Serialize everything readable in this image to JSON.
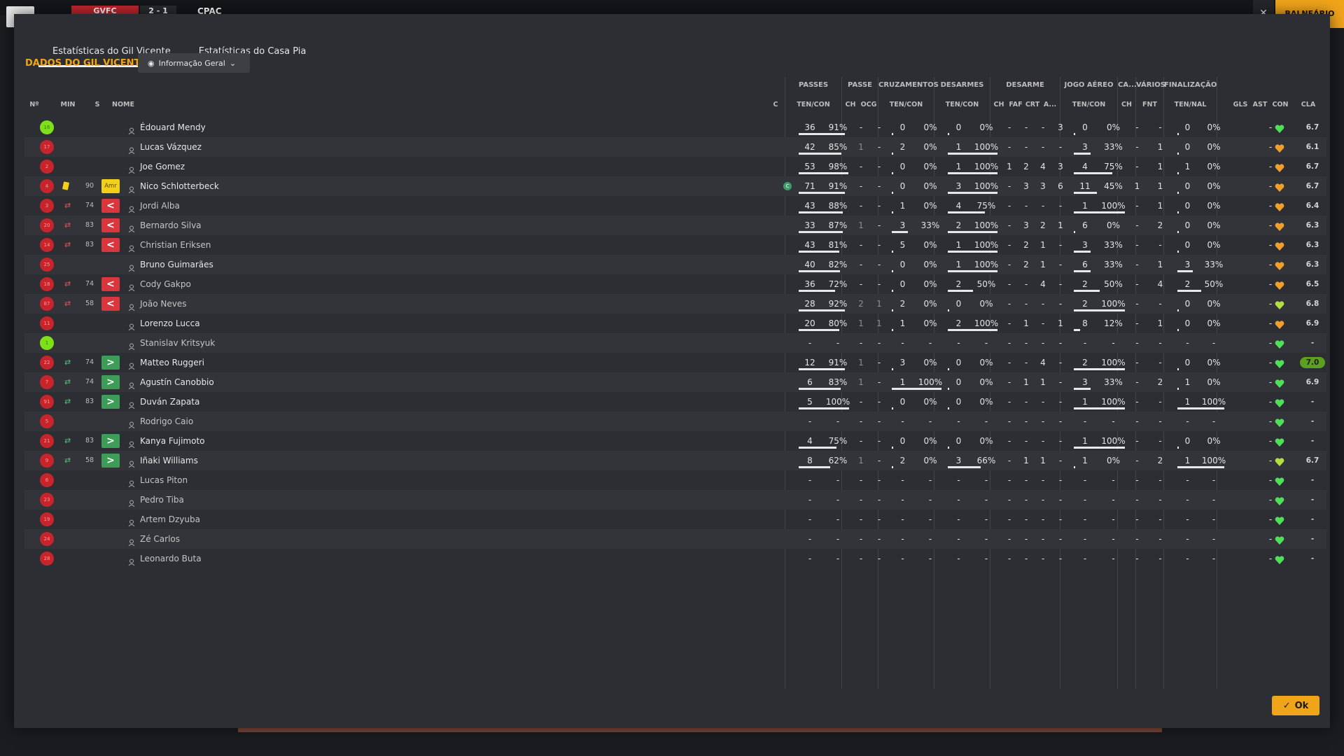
{
  "topbar": {
    "home_team": "GVFC",
    "score": "2 - 1",
    "away_team": "CPAC",
    "close_label": "✕",
    "dressing_room": "BALNEÁRIO"
  },
  "tabs": [
    {
      "label": "Estatísticas do Gil Vicente",
      "active": true
    },
    {
      "label": "Estatísticas do Casa Pia",
      "active": false
    }
  ],
  "section_title": "DADOS DO GIL VICENTE",
  "view_dropdown": "Informação Geral",
  "groups": [
    "PASSES",
    "PASSE",
    "CRUZAMENTOS",
    "DESARMES",
    "DESARME",
    "JOGO AÉREO",
    "CA...",
    "VÁRIOS",
    "FINALIZAÇÃO"
  ],
  "headers": {
    "num": "Nº",
    "min": "MIN",
    "s": "S",
    "name": "NOME",
    "c": "C",
    "passes": "TEN/CON",
    "passe_ch": "CH",
    "passe_ocg": "OCG",
    "cruz": "TEN/CON",
    "desarmes": "TEN/CON",
    "d_ch": "CH",
    "d_faf": "FAF",
    "d_crt": "CRT",
    "d_a": "A...",
    "aereo": "TEN/CON",
    "ca_ch": "CH",
    "fnt": "FNT",
    "finaliz": "TEN/NAL",
    "gls": "GLS",
    "ast": "AST",
    "con": "CON",
    "cla": "CLA"
  },
  "players": [
    {
      "num": "16",
      "gk": true,
      "min": "",
      "event": "",
      "s": "",
      "name": "Édouard Mendy",
      "active": true,
      "c": "",
      "p": [
        "36",
        "91%"
      ],
      "pch": "-",
      "pocg": "-",
      "cr": [
        "0",
        "0%"
      ],
      "de": [
        "0",
        "0%"
      ],
      "dch": "-",
      "faf": "-",
      "crt": "-",
      "a": "3",
      "ae": [
        "0",
        "0%"
      ],
      "cach": "-",
      "fnt": "-",
      "fi": [
        "0",
        "0%"
      ],
      "gls": "",
      "ast": "-",
      "heart": "green",
      "cla": "6.7",
      "best": false
    },
    {
      "num": "17",
      "min": "",
      "event": "",
      "s": "",
      "name": "Lucas Vázquez",
      "active": true,
      "c": "",
      "p": [
        "42",
        "85%"
      ],
      "pch": "1",
      "pocg": "-",
      "cr": [
        "2",
        "0%"
      ],
      "de": [
        "1",
        "100%"
      ],
      "dch": "-",
      "faf": "-",
      "crt": "-",
      "a": "-",
      "ae": [
        "3",
        "33%"
      ],
      "cach": "-",
      "fnt": "1",
      "fi": [
        "0",
        "0%"
      ],
      "gls": "",
      "ast": "-",
      "heart": "orange",
      "cla": "6.1",
      "best": false
    },
    {
      "num": "2",
      "min": "",
      "event": "",
      "s": "",
      "name": "Joe Gomez",
      "active": true,
      "c": "",
      "p": [
        "53",
        "98%"
      ],
      "pch": "-",
      "pocg": "-",
      "cr": [
        "0",
        "0%"
      ],
      "de": [
        "1",
        "100%"
      ],
      "dch": "1",
      "faf": "2",
      "crt": "4",
      "a": "3",
      "ae": [
        "4",
        "75%"
      ],
      "cach": "-",
      "fnt": "1",
      "fi": [
        "1",
        "0%"
      ],
      "gls": "",
      "ast": "-",
      "heart": "orange",
      "cla": "6.7",
      "best": false
    },
    {
      "num": "4",
      "min": "90",
      "event": "yc",
      "s": "Amr",
      "sclass": "yellow",
      "name": "Nico Schlotterbeck",
      "active": true,
      "c": "C",
      "p": [
        "71",
        "91%"
      ],
      "pch": "-",
      "pocg": "-",
      "cr": [
        "0",
        "0%"
      ],
      "de": [
        "3",
        "100%"
      ],
      "dch": "-",
      "faf": "3",
      "crt": "3",
      "a": "6",
      "ae": [
        "11",
        "45%"
      ],
      "cach": "1",
      "fnt": "1",
      "fi": [
        "0",
        "0%"
      ],
      "gls": "",
      "ast": "-",
      "heart": "orange",
      "cla": "6.7",
      "best": false
    },
    {
      "num": "3",
      "min": "74",
      "event": "out",
      "s": "<",
      "sclass": "red",
      "name": "Jordi Alba",
      "active": false,
      "c": "",
      "p": [
        "43",
        "88%"
      ],
      "pch": "-",
      "pocg": "-",
      "cr": [
        "1",
        "0%"
      ],
      "de": [
        "4",
        "75%"
      ],
      "dch": "-",
      "faf": "-",
      "crt": "-",
      "a": "-",
      "ae": [
        "1",
        "100%"
      ],
      "cach": "-",
      "fnt": "1",
      "fi": [
        "0",
        "0%"
      ],
      "gls": "",
      "ast": "-",
      "heart": "orange",
      "cla": "6.4",
      "best": false
    },
    {
      "num": "20",
      "min": "83",
      "event": "out",
      "s": "<",
      "sclass": "red",
      "name": "Bernardo Silva",
      "active": false,
      "c": "",
      "p": [
        "33",
        "87%"
      ],
      "pch": "1",
      "pocg": "-",
      "cr": [
        "3",
        "33%"
      ],
      "de": [
        "2",
        "100%"
      ],
      "dch": "-",
      "faf": "3",
      "crt": "2",
      "a": "1",
      "ae": [
        "6",
        "0%"
      ],
      "cach": "-",
      "fnt": "2",
      "fi": [
        "0",
        "0%"
      ],
      "gls": "",
      "ast": "-",
      "heart": "orange",
      "cla": "6.3",
      "best": false
    },
    {
      "num": "14",
      "min": "83",
      "event": "out",
      "s": "<",
      "sclass": "red",
      "name": "Christian Eriksen",
      "active": false,
      "c": "",
      "p": [
        "43",
        "81%"
      ],
      "pch": "-",
      "pocg": "-",
      "cr": [
        "5",
        "0%"
      ],
      "de": [
        "1",
        "100%"
      ],
      "dch": "-",
      "faf": "2",
      "crt": "1",
      "a": "-",
      "ae": [
        "3",
        "33%"
      ],
      "cach": "-",
      "fnt": "-",
      "fi": [
        "0",
        "0%"
      ],
      "gls": "",
      "ast": "-",
      "heart": "orange",
      "cla": "6.3",
      "best": false
    },
    {
      "num": "25",
      "min": "",
      "event": "",
      "s": "",
      "name": "Bruno Guimarães",
      "active": true,
      "c": "",
      "p": [
        "40",
        "82%"
      ],
      "pch": "-",
      "pocg": "-",
      "cr": [
        "0",
        "0%"
      ],
      "de": [
        "1",
        "100%"
      ],
      "dch": "-",
      "faf": "2",
      "crt": "1",
      "a": "-",
      "ae": [
        "6",
        "33%"
      ],
      "cach": "-",
      "fnt": "1",
      "fi": [
        "3",
        "33%"
      ],
      "gls": "",
      "ast": "-",
      "heart": "orange",
      "cla": "6.3",
      "best": false
    },
    {
      "num": "18",
      "min": "74",
      "event": "out",
      "s": "<",
      "sclass": "red",
      "name": "Cody Gakpo",
      "active": false,
      "c": "",
      "p": [
        "36",
        "72%"
      ],
      "pch": "-",
      "pocg": "-",
      "cr": [
        "0",
        "0%"
      ],
      "de": [
        "2",
        "50%"
      ],
      "dch": "-",
      "faf": "-",
      "crt": "4",
      "a": "-",
      "ae": [
        "2",
        "50%"
      ],
      "cach": "-",
      "fnt": "4",
      "fi": [
        "2",
        "50%"
      ],
      "gls": "",
      "ast": "-",
      "heart": "orange",
      "cla": "6.5",
      "best": false
    },
    {
      "num": "87",
      "min": "58",
      "event": "out",
      "s": "<",
      "sclass": "red",
      "name": "João Neves",
      "active": false,
      "c": "",
      "p": [
        "28",
        "92%"
      ],
      "pch": "2",
      "pocg": "1",
      "cr": [
        "2",
        "0%"
      ],
      "de": [
        "0",
        "0%"
      ],
      "dch": "-",
      "faf": "-",
      "crt": "-",
      "a": "-",
      "ae": [
        "2",
        "100%"
      ],
      "cach": "-",
      "fnt": "-",
      "fi": [
        "0",
        "0%"
      ],
      "gls": "",
      "ast": "-",
      "heart": "lime",
      "cla": "6.8",
      "best": false
    },
    {
      "num": "11",
      "min": "",
      "event": "",
      "s": "",
      "name": "Lorenzo Lucca",
      "active": true,
      "c": "",
      "p": [
        "20",
        "80%"
      ],
      "pch": "1",
      "pocg": "1",
      "cr": [
        "1",
        "0%"
      ],
      "de": [
        "2",
        "100%"
      ],
      "dch": "-",
      "faf": "1",
      "crt": "-",
      "a": "1",
      "ae": [
        "8",
        "12%"
      ],
      "cach": "-",
      "fnt": "1",
      "fi": [
        "0",
        "0%"
      ],
      "gls": "",
      "ast": "-",
      "heart": "orange",
      "cla": "6.9",
      "best": false
    },
    {
      "num": "1",
      "gk": true,
      "min": "",
      "event": "",
      "s": "",
      "name": "Stanislav Kritsyuk",
      "active": false,
      "c": "",
      "p": [
        "-",
        "-"
      ],
      "pch": "-",
      "pocg": "-",
      "cr": [
        "-",
        "-"
      ],
      "de": [
        "-",
        "-"
      ],
      "dch": "-",
      "faf": "-",
      "crt": "-",
      "a": "-",
      "ae": [
        "-",
        "-"
      ],
      "cach": "-",
      "fnt": "-",
      "fi": [
        "-",
        "-"
      ],
      "gls": "",
      "ast": "-",
      "heart": "green",
      "cla": "-",
      "best": false
    },
    {
      "num": "22",
      "min": "74",
      "event": "in",
      "s": ">",
      "sclass": "green",
      "name": "Matteo Ruggeri",
      "active": true,
      "c": "",
      "p": [
        "12",
        "91%"
      ],
      "pch": "1",
      "pocg": "-",
      "cr": [
        "3",
        "0%"
      ],
      "de": [
        "0",
        "0%"
      ],
      "dch": "-",
      "faf": "-",
      "crt": "4",
      "a": "-",
      "ae": [
        "2",
        "100%"
      ],
      "cach": "-",
      "fnt": "-",
      "fi": [
        "0",
        "0%"
      ],
      "gls": "",
      "ast": "-",
      "heart": "green",
      "cla": "7.0",
      "best": true
    },
    {
      "num": "7",
      "min": "74",
      "event": "in",
      "s": ">",
      "sclass": "green",
      "name": "Agustín Canobbio",
      "active": true,
      "c": "",
      "p": [
        "6",
        "83%"
      ],
      "pch": "1",
      "pocg": "-",
      "cr": [
        "1",
        "100%"
      ],
      "de": [
        "0",
        "0%"
      ],
      "dch": "-",
      "faf": "1",
      "crt": "1",
      "a": "-",
      "ae": [
        "3",
        "33%"
      ],
      "cach": "-",
      "fnt": "2",
      "fi": [
        "1",
        "0%"
      ],
      "gls": "",
      "ast": "-",
      "heart": "green",
      "cla": "6.9",
      "best": false
    },
    {
      "num": "91",
      "min": "83",
      "event": "in",
      "s": ">",
      "sclass": "green",
      "name": "Duván Zapata",
      "active": true,
      "c": "",
      "p": [
        "5",
        "100%"
      ],
      "pch": "-",
      "pocg": "-",
      "cr": [
        "0",
        "0%"
      ],
      "de": [
        "0",
        "0%"
      ],
      "dch": "-",
      "faf": "-",
      "crt": "-",
      "a": "-",
      "ae": [
        "1",
        "100%"
      ],
      "cach": "-",
      "fnt": "-",
      "fi": [
        "1",
        "100%"
      ],
      "gls": "",
      "ast": "-",
      "heart": "green",
      "cla": "-",
      "best": false
    },
    {
      "num": "5",
      "min": "",
      "event": "",
      "s": "",
      "name": "Rodrigo Caio",
      "active": false,
      "c": "",
      "p": [
        "-",
        "-"
      ],
      "pch": "-",
      "pocg": "-",
      "cr": [
        "-",
        "-"
      ],
      "de": [
        "-",
        "-"
      ],
      "dch": "-",
      "faf": "-",
      "crt": "-",
      "a": "-",
      "ae": [
        "-",
        "-"
      ],
      "cach": "-",
      "fnt": "-",
      "fi": [
        "-",
        "-"
      ],
      "gls": "",
      "ast": "-",
      "heart": "green",
      "cla": "-",
      "best": false
    },
    {
      "num": "21",
      "min": "83",
      "event": "in",
      "s": ">",
      "sclass": "green",
      "name": "Kanya Fujimoto",
      "active": true,
      "c": "",
      "p": [
        "4",
        "75%"
      ],
      "pch": "-",
      "pocg": "-",
      "cr": [
        "0",
        "0%"
      ],
      "de": [
        "0",
        "0%"
      ],
      "dch": "-",
      "faf": "-",
      "crt": "-",
      "a": "-",
      "ae": [
        "1",
        "100%"
      ],
      "cach": "-",
      "fnt": "-",
      "fi": [
        "0",
        "0%"
      ],
      "gls": "",
      "ast": "-",
      "heart": "green",
      "cla": "-",
      "best": false
    },
    {
      "num": "9",
      "min": "58",
      "event": "in",
      "s": ">",
      "sclass": "green",
      "name": "Iñaki Williams",
      "active": true,
      "c": "",
      "p": [
        "8",
        "62%"
      ],
      "pch": "1",
      "pocg": "-",
      "cr": [
        "2",
        "0%"
      ],
      "de": [
        "3",
        "66%"
      ],
      "dch": "-",
      "faf": "1",
      "crt": "1",
      "a": "-",
      "ae": [
        "1",
        "0%"
      ],
      "cach": "-",
      "fnt": "2",
      "fi": [
        "1",
        "100%"
      ],
      "gls": "",
      "ast": "-",
      "heart": "lime",
      "cla": "6.7",
      "best": false
    },
    {
      "num": "6",
      "min": "",
      "event": "",
      "s": "",
      "name": "Lucas Piton",
      "active": false,
      "c": "",
      "p": [
        "-",
        "-"
      ],
      "pch": "-",
      "pocg": "-",
      "cr": [
        "-",
        "-"
      ],
      "de": [
        "-",
        "-"
      ],
      "dch": "-",
      "faf": "-",
      "crt": "-",
      "a": "-",
      "ae": [
        "-",
        "-"
      ],
      "cach": "-",
      "fnt": "-",
      "fi": [
        "-",
        "-"
      ],
      "gls": "",
      "ast": "-",
      "heart": "green",
      "cla": "-",
      "best": false
    },
    {
      "num": "23",
      "min": "",
      "event": "",
      "s": "",
      "name": "Pedro Tiba",
      "active": false,
      "c": "",
      "p": [
        "-",
        "-"
      ],
      "pch": "-",
      "pocg": "-",
      "cr": [
        "-",
        "-"
      ],
      "de": [
        "-",
        "-"
      ],
      "dch": "-",
      "faf": "-",
      "crt": "-",
      "a": "-",
      "ae": [
        "-",
        "-"
      ],
      "cach": "-",
      "fnt": "-",
      "fi": [
        "-",
        "-"
      ],
      "gls": "",
      "ast": "-",
      "heart": "green",
      "cla": "-",
      "best": false
    },
    {
      "num": "19",
      "min": "",
      "event": "",
      "s": "",
      "name": "Artem Dzyuba",
      "active": false,
      "c": "",
      "p": [
        "-",
        "-"
      ],
      "pch": "-",
      "pocg": "-",
      "cr": [
        "-",
        "-"
      ],
      "de": [
        "-",
        "-"
      ],
      "dch": "-",
      "faf": "-",
      "crt": "-",
      "a": "-",
      "ae": [
        "-",
        "-"
      ],
      "cach": "-",
      "fnt": "-",
      "fi": [
        "-",
        "-"
      ],
      "gls": "",
      "ast": "-",
      "heart": "green",
      "cla": "-",
      "best": false
    },
    {
      "num": "24",
      "min": "",
      "event": "",
      "s": "",
      "name": "Zé Carlos",
      "active": false,
      "c": "",
      "p": [
        "-",
        "-"
      ],
      "pch": "-",
      "pocg": "-",
      "cr": [
        "-",
        "-"
      ],
      "de": [
        "-",
        "-"
      ],
      "dch": "-",
      "faf": "-",
      "crt": "-",
      "a": "-",
      "ae": [
        "-",
        "-"
      ],
      "cach": "-",
      "fnt": "-",
      "fi": [
        "-",
        "-"
      ],
      "gls": "",
      "ast": "-",
      "heart": "green",
      "cla": "-",
      "best": false
    },
    {
      "num": "28",
      "min": "",
      "event": "",
      "s": "",
      "name": "Leonardo Buta",
      "active": false,
      "c": "",
      "p": [
        "-",
        "-"
      ],
      "pch": "-",
      "pocg": "-",
      "cr": [
        "-",
        "-"
      ],
      "de": [
        "-",
        "-"
      ],
      "dch": "-",
      "faf": "-",
      "crt": "-",
      "a": "-",
      "ae": [
        "-",
        "-"
      ],
      "cach": "-",
      "fnt": "-",
      "fi": [
        "-",
        "-"
      ],
      "gls": "",
      "ast": "-",
      "heart": "green",
      "cla": "-",
      "best": false
    }
  ],
  "ok_label": "Ok",
  "colors": {
    "accent": "#f0a41a",
    "heart_green": "#4fe05a",
    "heart_orange": "#f0a02a",
    "heart_lime": "#b0e040",
    "best_rating": "#5da020"
  }
}
